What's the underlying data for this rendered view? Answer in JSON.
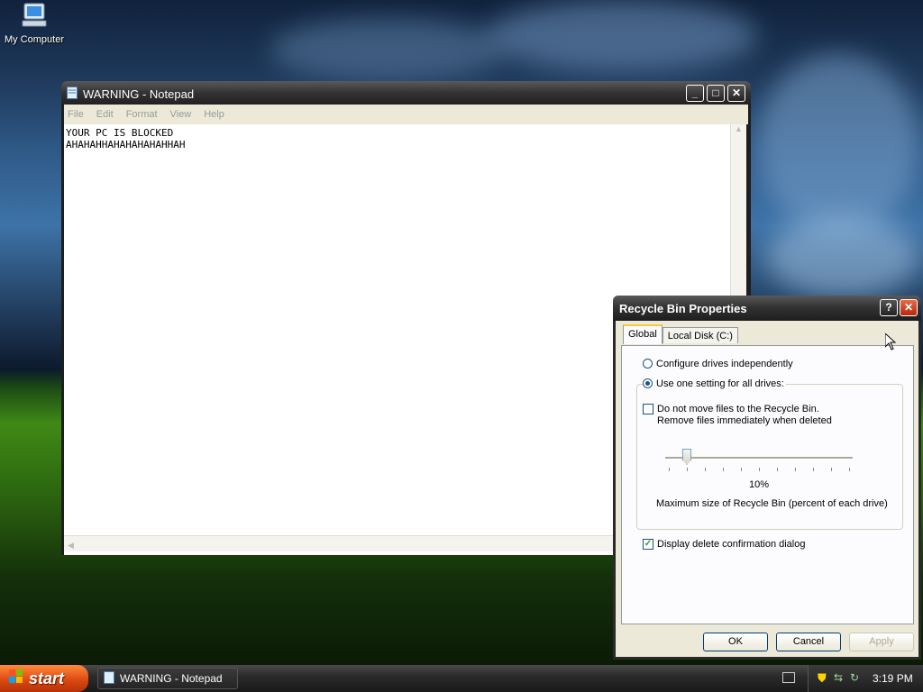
{
  "desktop": {
    "icons": [
      {
        "label": "My Computer",
        "icon": "my-computer-icon"
      }
    ]
  },
  "notepad": {
    "title": "WARNING - Notepad",
    "menu": [
      "File",
      "Edit",
      "Format",
      "View",
      "Help"
    ],
    "content_lines": [
      "YOUR PC IS BLOCKED",
      "AHAHAHHAHAHAHAHAHHAH"
    ]
  },
  "dialog": {
    "title": "Recycle Bin Properties",
    "tabs": [
      "Global",
      "Local Disk (C:)"
    ],
    "active_tab": "Global",
    "options": {
      "configure_independently": "Configure drives independently",
      "one_setting": "Use one setting for all drives:",
      "no_move_line1": "Do not move files to the Recycle Bin.",
      "no_move_line2": "Remove files immediately when deleted",
      "display_confirm": "Display delete confirmation dialog"
    },
    "selected_option": "one_setting",
    "do_not_move_checked": false,
    "display_confirm_checked": true,
    "slider_value_label": "10%",
    "slider_percent": 10,
    "slider_caption": "Maximum size of Recycle Bin (percent of each drive)",
    "buttons": {
      "ok": "OK",
      "cancel": "Cancel",
      "apply": "Apply"
    }
  },
  "taskbar": {
    "start_label": "start",
    "tasks": [
      "WARNING - Notepad"
    ],
    "clock": "3:19 PM"
  },
  "colors": {
    "accent_titlebar": "#2b2b2b",
    "start_button": "#d9450f",
    "dialog_bg": "#ece9d8"
  }
}
